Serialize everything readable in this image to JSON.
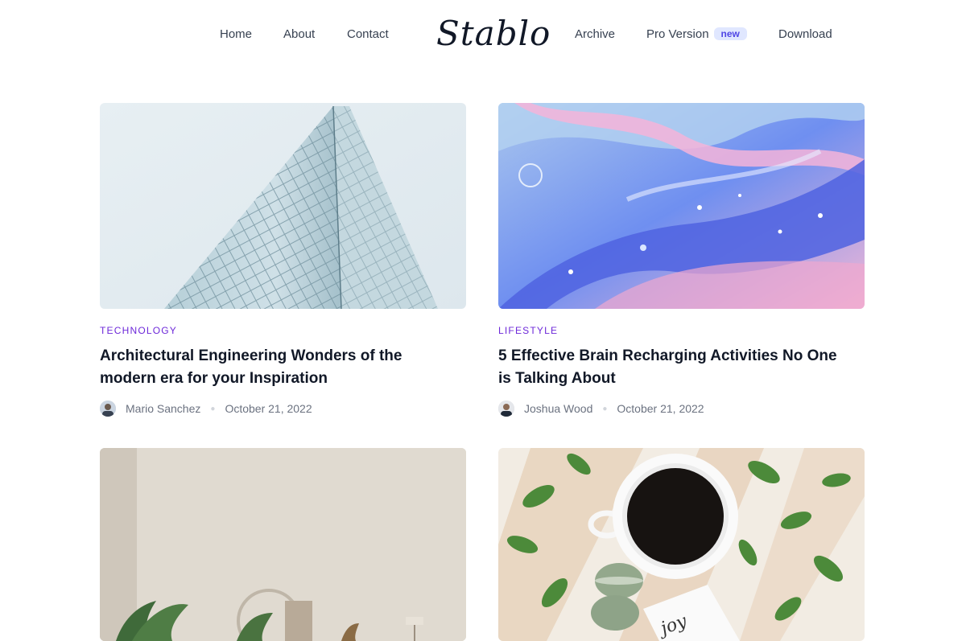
{
  "nav": {
    "left_links": [
      "Home",
      "About",
      "Contact"
    ],
    "logo": "Stablo",
    "right_links": [
      "Archive",
      "Pro Version",
      "Download"
    ],
    "pro_badge": "new"
  },
  "posts": [
    {
      "category": "TECHNOLOGY",
      "title": "Architectural Engineering Wonders of the modern era for your Inspiration",
      "author": "Mario Sanchez",
      "date": "October 21, 2022"
    },
    {
      "category": "LIFESTYLE",
      "title": "5 Effective Brain Recharging Activities No One is Talking About",
      "author": "Joshua Wood",
      "date": "October 21, 2022"
    },
    {
      "image": "living-room-plants"
    },
    {
      "image": "coffee-leaves-macarons"
    }
  ],
  "colors": {
    "accent": "#6d28d9",
    "badge_bg": "#e0e7ff",
    "badge_text": "#4f46e5"
  }
}
